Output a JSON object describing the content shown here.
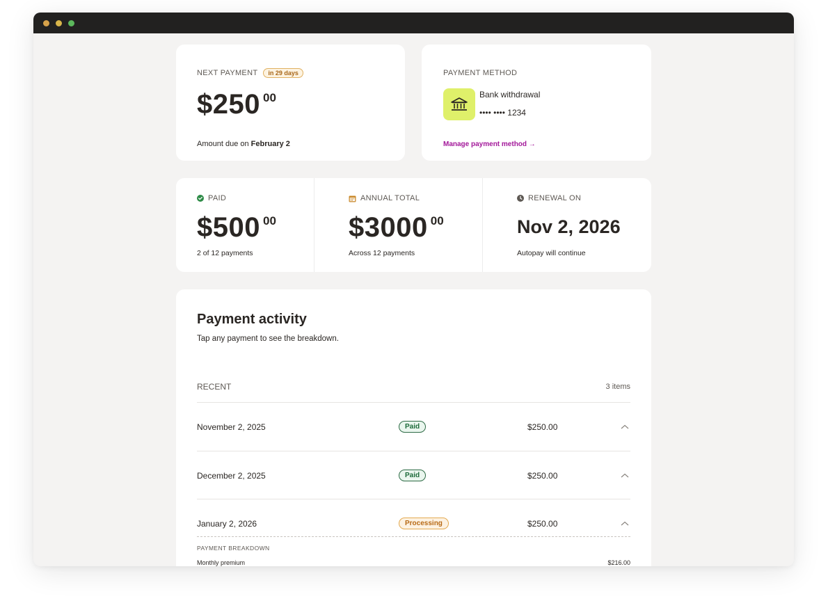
{
  "next_payment": {
    "label": "NEXT PAYMENT",
    "badge": "in 29 days",
    "amount_main": "$250",
    "amount_cents": "00",
    "due_prefix": "Amount due on ",
    "due_date": "February 2"
  },
  "payment_method": {
    "label": "PAYMENT METHOD",
    "icon": "bank-icon",
    "name": "Bank withdrawal",
    "account": "•••• •••• 1234",
    "manage_link": "Manage payment method →",
    "tile_color": "#dff06a",
    "link_color": "#a3189a"
  },
  "stats": {
    "paid": {
      "icon": "check-circle-icon",
      "label": "PAID",
      "amount_main": "$500",
      "amount_cents": "00",
      "sub": "2 of 12 payments"
    },
    "annual": {
      "icon": "calendar-icon",
      "label": "ANNUAL TOTAL",
      "amount_main": "$3000",
      "amount_cents": "00",
      "sub": "Across 12 payments"
    },
    "renewal": {
      "icon": "clock-icon",
      "label": "RENEWAL ON",
      "date": "Nov 2, 2026",
      "sub": "Autopay will continue"
    }
  },
  "activity": {
    "title": "Payment activity",
    "subtitle": "Tap any payment to see the breakdown.",
    "section_label": "RECENT",
    "count": "3 items",
    "rows": [
      {
        "date": "November 2, 2025",
        "status": "Paid",
        "amount": "$250.00"
      },
      {
        "date": "December 2, 2025",
        "status": "Paid",
        "amount": "$250.00"
      },
      {
        "date": "January 2, 2026",
        "status": "Processing",
        "amount": "$250.00"
      }
    ],
    "breakdown": {
      "label": "PAYMENT BREAKDOWN",
      "items": [
        {
          "name": "Monthly premium",
          "amount": "$216.00"
        }
      ]
    }
  }
}
